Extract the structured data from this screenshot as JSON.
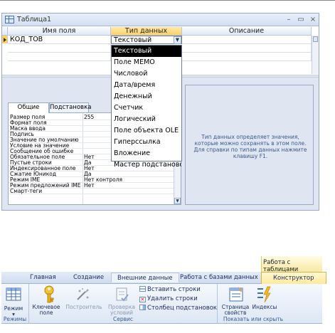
{
  "window": {
    "title": "Таблица1",
    "controls": [
      "–",
      "▭",
      "×"
    ]
  },
  "grid": {
    "headers": [
      "Имя поля",
      "Тип данных",
      "Описание"
    ],
    "row": {
      "field_name": "КОД_ТОВ",
      "data_type": "Текстовый",
      "description": ""
    }
  },
  "dropdown": {
    "options": [
      "Текстовый",
      "Поле MEMO",
      "Числовой",
      "Дата/время",
      "Денежный",
      "Счетчик",
      "Логический",
      "Поле объекта OLE",
      "Гиперссылка",
      "Вложение",
      "Мастер подстановок..."
    ],
    "selected_index": 0
  },
  "properties": {
    "tabs": [
      "Общие",
      "Подстановка"
    ],
    "active_tab": 0,
    "rows": [
      {
        "name": "Размер поля",
        "value": "255"
      },
      {
        "name": "Формат поля",
        "value": ""
      },
      {
        "name": "Маска ввода",
        "value": ""
      },
      {
        "name": "Подпись",
        "value": ""
      },
      {
        "name": "Значение по умолчанию",
        "value": ""
      },
      {
        "name": "Условие на значение",
        "value": ""
      },
      {
        "name": "Сообщение об ошибке",
        "value": ""
      },
      {
        "name": "Обязательное поле",
        "value": "Нет"
      },
      {
        "name": "Пустые строки",
        "value": "Да"
      },
      {
        "name": "Индексированное поле",
        "value": "Нет"
      },
      {
        "name": "Сжатие Юникод",
        "value": "Да"
      },
      {
        "name": "Режим IME",
        "value": "Нет контроля"
      },
      {
        "name": "Режим предложений IME",
        "value": "Нет"
      },
      {
        "name": "Смарт-теги",
        "value": ""
      }
    ]
  },
  "help_text": "Тип данных определяет значения, которые можно сохранять в этом поле. Для справки по типам данных нажмите клавишу F1.",
  "ribbon": {
    "context_title": "Работа с таблицами",
    "tabs": [
      "Главная",
      "Создание",
      "Внешние данные",
      "Работа с базами данных",
      "Конструктор"
    ],
    "active_tab": 4,
    "groups": {
      "modes": {
        "label": "Режимы",
        "view_button": "Режим"
      },
      "service": {
        "label": "Сервис",
        "key_field": "Ключевое поле",
        "builder": "Построитель",
        "test_rules": "Проверка условий",
        "insert_rows": "Вставить строки",
        "delete_rows": "Удалить строки",
        "lookup_column": "Столбец подстановок"
      },
      "show_hide": {
        "label": "Показать или скрыть",
        "property_sheet": "Страница свойств",
        "indexes": "Индексы"
      }
    },
    "colors": {
      "accent": "#ffd166",
      "context": "#f8e9a4",
      "text": "#1e3160"
    }
  }
}
